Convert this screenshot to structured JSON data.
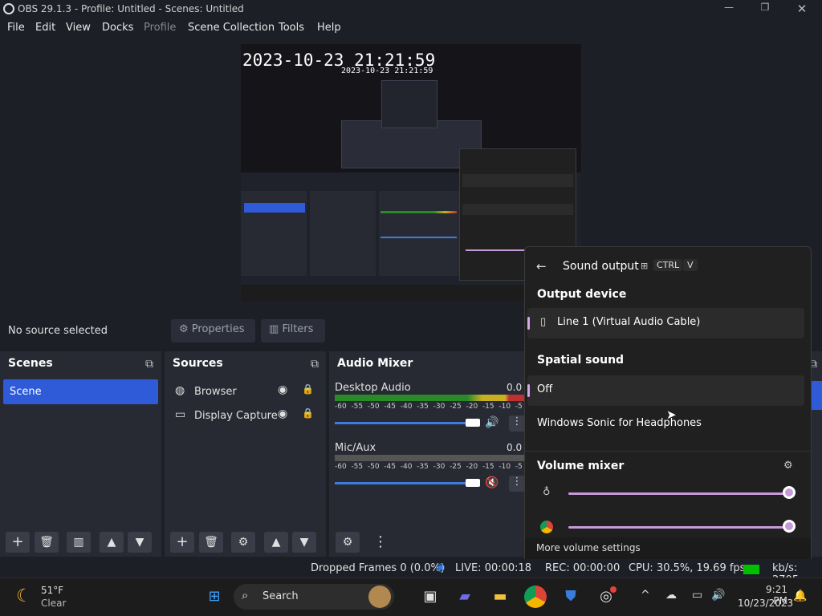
{
  "window": {
    "title": "OBS 29.1.3 - Profile: Untitled - Scenes: Untitled"
  },
  "menu": [
    "File",
    "Edit",
    "View",
    "Docks",
    "Profile",
    "Scene Collection",
    "Tools",
    "Help"
  ],
  "preview": {
    "timestamp_large": "2023-10-23 21:21:59",
    "timestamp_small": "2023-10-23 21:21:59"
  },
  "controls": {
    "no_source": "No source selected",
    "properties": "Properties",
    "filters": "Filters"
  },
  "scenes": {
    "title": "Scenes",
    "items": [
      "Scene"
    ]
  },
  "sources": {
    "title": "Sources",
    "items": [
      "Browser",
      "Display Capture"
    ]
  },
  "mixer": {
    "title": "Audio Mixer",
    "channels": [
      {
        "name": "Desktop Audio",
        "db": "0.0 d",
        "muted": false,
        "level": 0.95
      },
      {
        "name": "Mic/Aux",
        "db": "0.0 d",
        "muted": true,
        "level": 0.95
      }
    ],
    "ticks": [
      "-60",
      "-55",
      "-50",
      "-45",
      "-40",
      "-35",
      "-30",
      "-25",
      "-20",
      "-15",
      "-10",
      "-5"
    ]
  },
  "sound_output": {
    "title": "Sound output",
    "shortcut": [
      "CTRL",
      "V"
    ],
    "output_device_label": "Output device",
    "output_device": "Line 1 (Virtual Audio Cable)",
    "spatial_label": "Spatial sound",
    "spatial_options": [
      "Off",
      "Windows Sonic for Headphones"
    ],
    "volume_mixer_label": "Volume mixer",
    "more_settings": "More volume settings",
    "volume_levels": [
      1.0,
      1.0
    ]
  },
  "status": {
    "dropped": "Dropped Frames 0 (0.0%)",
    "live": "LIVE: 00:00:18",
    "rec": "REC: 00:00:00",
    "cpu": "CPU: 30.5%, 19.69 fps",
    "kbps": "kb/s: 2705"
  },
  "taskbar": {
    "weather_temp": "51°F",
    "weather_desc": "Clear",
    "search": "Search",
    "time": "9:21 PM",
    "date": "10/23/2023"
  },
  "colors": {
    "accent": "#2f5ad8",
    "mixer_blue": "#3a7ddb",
    "sound_accent": "#c69ad8",
    "muted_red": "#e0443e",
    "green_indicator": "#00c000"
  }
}
